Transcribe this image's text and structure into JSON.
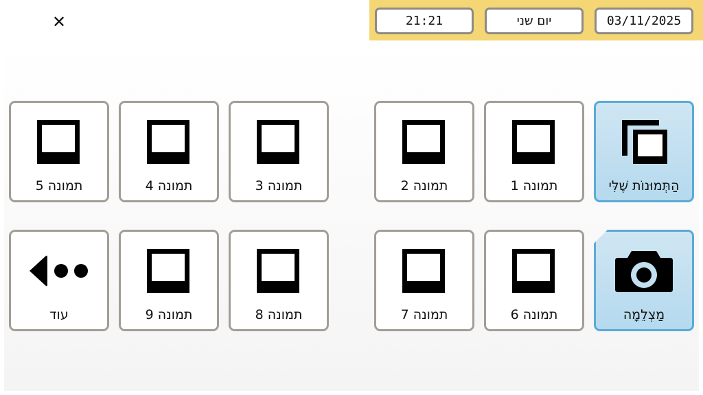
{
  "header": {
    "close_symbol": "✕",
    "time": "21:21",
    "day": "יום שני",
    "date": "03/11/2025"
  },
  "tiles": {
    "my_photos": {
      "label": "הַתְּמוּנוֹת שֶׁלִּי",
      "icon": "photo-stack-icon"
    },
    "photo_1": {
      "label": "תמונה 1",
      "icon": "photo-frame-icon"
    },
    "photo_2": {
      "label": "תמונה 2",
      "icon": "photo-frame-icon"
    },
    "photo_3": {
      "label": "תמונה 3",
      "icon": "photo-frame-icon"
    },
    "photo_4": {
      "label": "תמונה 4",
      "icon": "photo-frame-icon"
    },
    "photo_5": {
      "label": "תמונה 5",
      "icon": "photo-frame-icon"
    },
    "camera": {
      "label": "מַצְלֵמָה",
      "icon": "camera-icon"
    },
    "photo_6": {
      "label": "תמונה 6",
      "icon": "photo-frame-icon"
    },
    "photo_7": {
      "label": "תמונה 7",
      "icon": "photo-frame-icon"
    },
    "photo_8": {
      "label": "תמונה 8",
      "icon": "photo-frame-icon"
    },
    "photo_9": {
      "label": "תמונה 9",
      "icon": "photo-frame-icon"
    },
    "more": {
      "label": "עוד",
      "icon": "more-arrow-icon"
    }
  },
  "colors": {
    "status_bar": "#f4d774",
    "tile_border": "#a29d95",
    "highlight_border": "#5aaad6",
    "highlight_fill": "#c3e0f1"
  }
}
